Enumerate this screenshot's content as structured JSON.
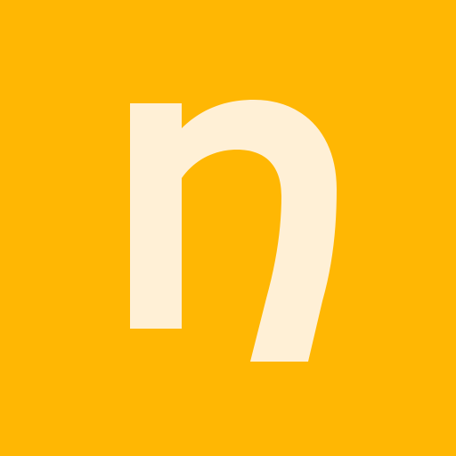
{
  "icon": {
    "name": "app-logo-icon",
    "logo_letter": "n",
    "background_color": "#FFB703",
    "glyph_color": "#FFF0D6"
  }
}
